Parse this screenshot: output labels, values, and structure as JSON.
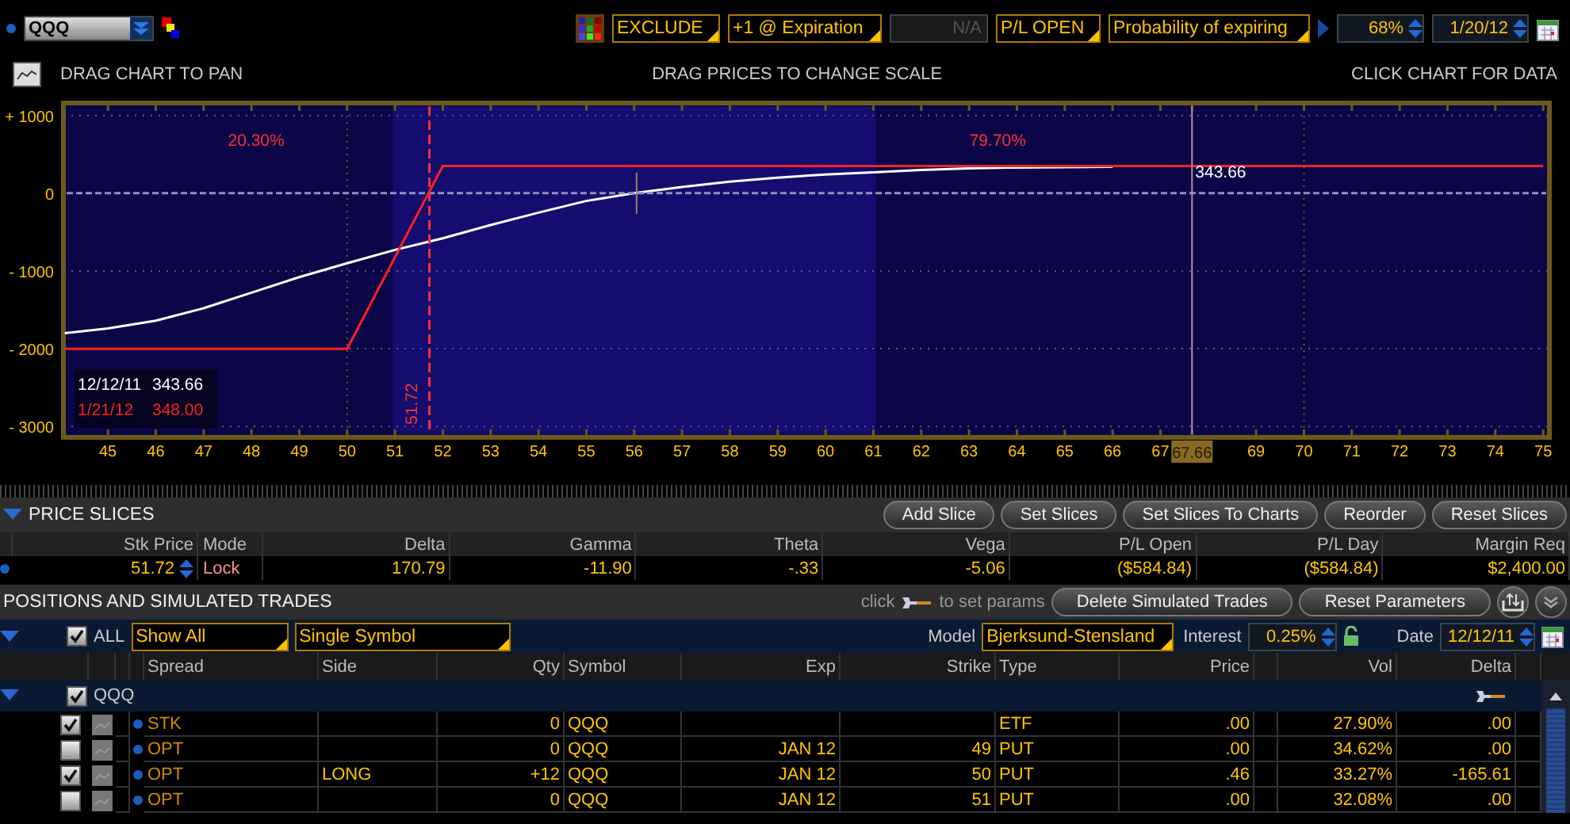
{
  "toolbar": {
    "symbol": "QQQ",
    "commissions": "EXCLUDE",
    "plot_lines": "+1 @ Expiration",
    "step": {
      "value": "N/A",
      "disabled": true
    },
    "prob_mode_button": "P/L OPEN",
    "prob_mode": "Probability of expiring",
    "prob_range": "68%",
    "prob_date": "1/20/12"
  },
  "hints": {
    "left": "DRAG CHART TO PAN",
    "center": "DRAG PRICES TO CHANGE SCALE",
    "right": "CLICK CHART FOR DATA"
  },
  "chart": {
    "legend": [
      {
        "value": "343.66"
      },
      {
        "value": "348.00"
      }
    ],
    "chart_data": {
      "type": "line",
      "grid": true,
      "x": [
        44.1,
        45,
        46,
        47,
        48,
        49,
        50,
        51,
        52,
        53,
        54,
        55,
        56,
        57,
        58,
        59,
        60,
        61,
        62,
        63,
        64,
        65,
        66,
        67,
        68,
        69,
        70,
        71,
        72,
        73,
        74,
        75
      ],
      "series": [
        {
          "name": "12/12/11",
          "color": "#ffffff",
          "values": [
            -1800,
            -1740,
            -1640,
            -1480,
            -1280,
            -1080,
            -900,
            -730,
            -580,
            -410,
            -250,
            -100,
            0,
            80,
            150,
            200,
            240,
            270,
            300,
            320,
            330,
            335,
            340,
            null,
            null,
            null,
            null,
            null,
            null,
            null,
            null,
            null
          ]
        },
        {
          "name": "1/21/12",
          "color": "#ff2020",
          "values": [
            -2000,
            -2000,
            -2000,
            -2000,
            -2000,
            -2000,
            -2000,
            -820,
            348,
            348,
            348,
            348,
            348,
            348,
            348,
            348,
            348,
            348,
            348,
            348,
            348,
            348,
            348,
            348,
            348,
            348,
            348,
            348,
            348,
            348,
            348,
            348
          ]
        }
      ],
      "xlim": [
        44.07,
        75.13
      ],
      "ylim": [
        -3140,
        1160
      ],
      "xticks": [
        45,
        46,
        47,
        48,
        49,
        50,
        51,
        52,
        53,
        54,
        55,
        56,
        57,
        58,
        59,
        60,
        61,
        62,
        63,
        64,
        65,
        66,
        67,
        {
          "value": 67.66,
          "label": "67.66"
        },
        69,
        70,
        71,
        72,
        73,
        74,
        75
      ],
      "yticks": [
        {
          "value": 1000,
          "label": "+ 1000"
        },
        {
          "value": 0,
          "label": "0"
        },
        {
          "value": -1000,
          "label": "- 1000"
        },
        {
          "value": -2000,
          "label": "- 2000"
        },
        {
          "value": -3000,
          "label": "- 3000"
        }
      ],
      "bands": [
        {
          "axis": "x",
          "from": 50.95,
          "to": 61.05
        }
      ],
      "ref_lines": [
        {
          "axis": "y",
          "value": 0
        },
        {
          "axis": "x",
          "value": 51.72,
          "label": "51.72",
          "color": "#ff3030"
        },
        {
          "axis": "x",
          "value": 67.66,
          "color": "#b09090"
        }
      ],
      "annotations": [
        "20.30%",
        "79.70%",
        "343.66"
      ]
    }
  },
  "price_slices": {
    "title": "PRICE SLICES",
    "expanded": true,
    "buttons": [
      "Add Slice",
      "Set Slices",
      "Set Slices To Charts",
      "Reorder",
      "Reset Slices"
    ],
    "columns": [
      "Stk Price",
      "Mode",
      "Delta",
      "Gamma",
      "Theta",
      "Vega",
      "P/L Open",
      "P/L Day",
      "Margin Req"
    ],
    "rows": [
      {
        "cells": [
          "51.72",
          "Lock",
          "170.79",
          "-11.90",
          "-.33",
          "-5.06",
          "($584.84)",
          "($584.84)",
          "$2,400.00"
        ]
      }
    ]
  },
  "positions": {
    "title": "POSITIONS AND SIMULATED TRADES",
    "hint_before": "click",
    "hint_after": "to set params",
    "buttons": [
      "Delete Simulated Trades",
      "Reset Parameters"
    ],
    "filter": {
      "expanded": true,
      "all_checked": true,
      "all_label": "ALL",
      "show": "Show All",
      "symbol_mode": "Single Symbol",
      "model_label": "Model",
      "model": "Bjerksund-Stensland",
      "interest_label": "Interest",
      "interest": "0.25%",
      "date_label": "Date",
      "date": "12/12/11"
    },
    "columns": [
      "Spread",
      "Side",
      "Qty",
      "Symbol",
      "Exp",
      "Strike",
      "Type",
      "Price",
      "Vol",
      "Delta"
    ],
    "group": {
      "symbol": "QQQ",
      "checked": true,
      "expanded": true
    },
    "rows": [
      {
        "checked": true,
        "spread": "STK",
        "qty": "0",
        "symbol": "QQQ",
        "type": "ETF",
        "price": ".00",
        "vol": "27.90%",
        "delta": ".00"
      },
      {
        "checked": false,
        "spread": "OPT",
        "qty": "0",
        "symbol": "QQQ",
        "exp": "JAN 12",
        "strike": "49",
        "type": "PUT",
        "price": ".00",
        "vol": "34.62%",
        "delta": ".00"
      },
      {
        "checked": true,
        "spread": "OPT",
        "side": "LONG",
        "qty": "+12",
        "symbol": "QQQ",
        "exp": "JAN 12",
        "strike": "50",
        "type": "PUT",
        "price": ".46",
        "vol": "33.27%",
        "delta": "-165.61"
      },
      {
        "checked": false,
        "spread": "OPT",
        "qty": "0",
        "symbol": "QQQ",
        "exp": "JAN 12",
        "strike": "51",
        "type": "PUT",
        "price": ".00",
        "vol": "32.08%",
        "delta": ".00"
      }
    ]
  }
}
